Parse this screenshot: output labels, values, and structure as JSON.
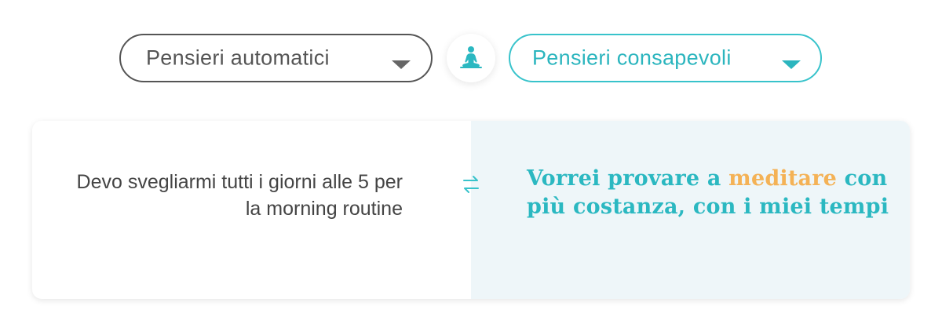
{
  "selectors": {
    "automatic": {
      "label": "Pensieri automatici"
    },
    "mindful": {
      "label": "Pensieri consapevoli"
    }
  },
  "center_icon": "meditation-icon",
  "card": {
    "automatic_thought": "Devo svegliarmi tutti i giorni alle 5 per la morning routine",
    "mindful_thought": {
      "before": "Vorrei provare a ",
      "highlight": "meditare",
      "after": " con più costanza, con i miei tempi"
    },
    "swap_icon": "swap-arrows-icon"
  },
  "colors": {
    "accent": "#2bb5be",
    "highlight": "#f4b256",
    "neutral_border": "#555555",
    "panel_tint": "#eef6f9"
  }
}
